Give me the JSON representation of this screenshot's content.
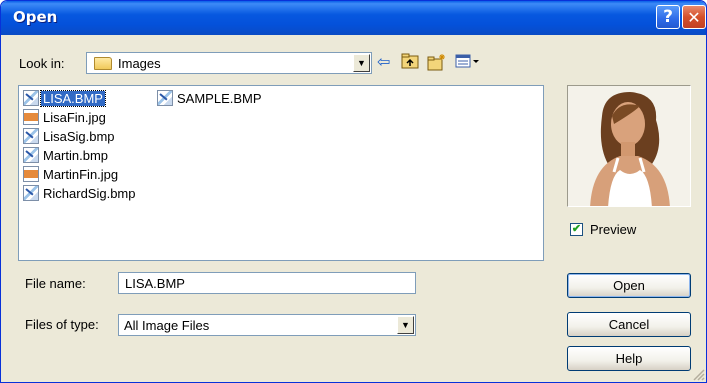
{
  "window": {
    "title": "Open"
  },
  "titlebar_buttons": {
    "help": "?",
    "close": "✕"
  },
  "look_in": {
    "label": "Look in:",
    "folder": "Images"
  },
  "toolbar": {
    "back_icon": "back-arrow-icon",
    "up_icon": "up-folder-icon",
    "new_folder_icon": "new-folder-icon",
    "view_icon": "view-menu-icon"
  },
  "files": [
    {
      "name": "LISA.BMP",
      "type": "bmp",
      "selected": true
    },
    {
      "name": "LisaFin.jpg",
      "type": "jpg"
    },
    {
      "name": "LisaSig.bmp",
      "type": "bmp"
    },
    {
      "name": "Martin.bmp",
      "type": "bmp"
    },
    {
      "name": "MartinFin.jpg",
      "type": "jpg"
    },
    {
      "name": "RichardSig.bmp",
      "type": "bmp"
    },
    {
      "name": "SAMPLE.BMP",
      "type": "bmp"
    }
  ],
  "preview": {
    "checkbox_label": "Preview",
    "checked": true
  },
  "file_name": {
    "label": "File name:",
    "value": "LISA.BMP"
  },
  "files_of_type": {
    "label": "Files of type:",
    "value": "All Image Files"
  },
  "buttons": {
    "open": "Open",
    "cancel": "Cancel",
    "help": "Help"
  }
}
